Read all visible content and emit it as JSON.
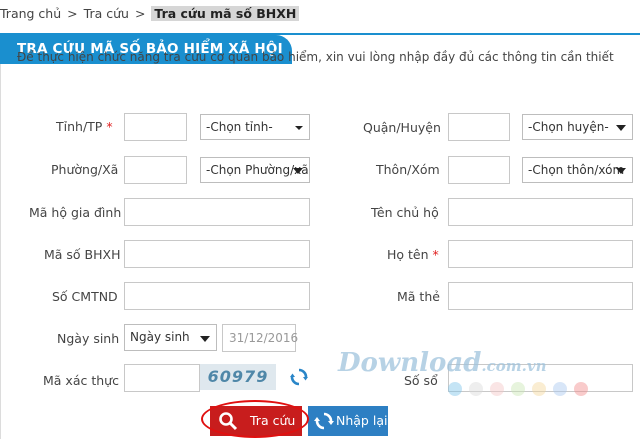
{
  "breadcrumb": {
    "home": "Trang chủ",
    "lookup": "Tra cứu",
    "current": "Tra cứu mã số BHXH",
    "separator": ">"
  },
  "panel": {
    "title": "TRA CỨU MÃ SỐ BẢO HIỂM XÃ HỘI",
    "intro": "Để thực hiện chức năng tra cứu cơ quan bảo hiểm, xin vui lòng nhập đầy đủ các thông tin cần thiết"
  },
  "form": {
    "province_label": "Tỉnh/TP",
    "province_select": "-Chọn tỉnh-",
    "district_label": "Quận/Huyện",
    "district_select": "-Chọn huyện-",
    "ward_label": "Phường/Xã",
    "ward_select": "-Chọn Phường/xã",
    "village_label": "Thôn/Xóm",
    "village_select": "-Chọn thôn/xóm",
    "household_code_label": "Mã hộ gia đình",
    "household_head_label": "Tên chủ hộ",
    "bhxh_code_label": "Mã số BHXH",
    "fullname_label": "Họ tên",
    "id_number_label": "Số CMTND",
    "card_code_label": "Mã thẻ",
    "dob_label": "Ngày sinh",
    "dob_select": "Ngày sinh",
    "dob_value": "31/12/2016",
    "captcha_label": "Mã xác thực",
    "captcha_text": "60979",
    "house_number_label": "Số sổ",
    "required_mark": "*"
  },
  "buttons": {
    "search": "Tra cứu",
    "reset": "Nhập lại"
  },
  "watermark": {
    "brand": "Download",
    "domain": ".com.vn"
  },
  "colors": {
    "accent_blue": "#1a8fcf",
    "search_red": "#c81d1d",
    "reset_blue": "#2d7fc3",
    "required_red": "#e02020",
    "watermark_dots": [
      "#7cc3e8",
      "#d9d9d9",
      "#f3c5c5",
      "#c9e6b4",
      "#f5d79c",
      "#a8c8f0",
      "#f28b8b"
    ]
  }
}
